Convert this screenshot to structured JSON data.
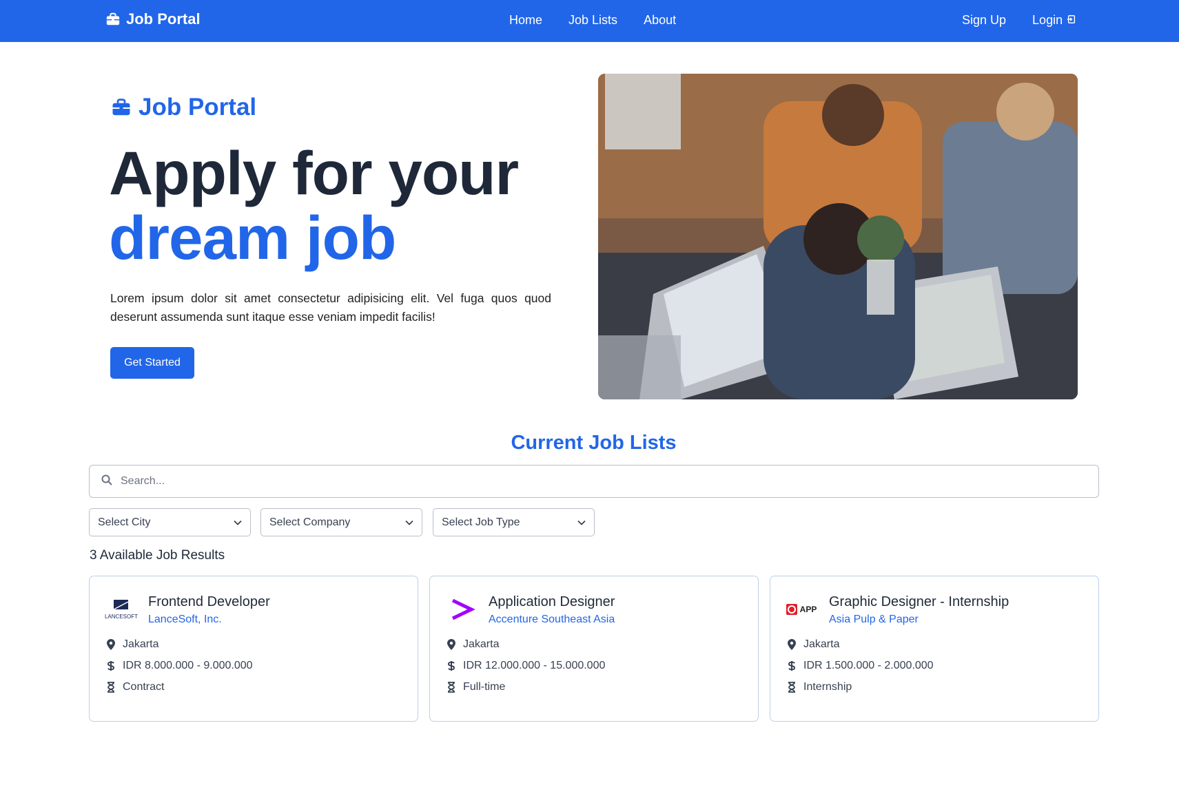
{
  "navbar": {
    "brand": "Job Portal",
    "links": [
      "Home",
      "Job Lists",
      "About"
    ],
    "signup": "Sign Up",
    "login": "Login"
  },
  "hero": {
    "brand": "Job Portal",
    "title_line1": "Apply for your",
    "title_line2": "dream job",
    "description": "Lorem ipsum dolor sit amet consectetur adipisicing elit. Vel fuga quos quod deserunt assumenda sunt itaque esse veniam impedit facilis!",
    "cta": "Get Started"
  },
  "joblist": {
    "title": "Current Job Lists",
    "search_placeholder": "Search...",
    "filters": [
      "Select City",
      "Select Company",
      "Select Job Type"
    ],
    "results_text": "3 Available Job Results",
    "jobs": [
      {
        "title": "Frontend Developer",
        "company": "LanceSoft, Inc.",
        "location": "Jakarta",
        "salary": "IDR 8.000.000 - 9.000.000",
        "type": "Contract",
        "logo_text": "LANCESOFT"
      },
      {
        "title": "Application Designer",
        "company": "Accenture Southeast Asia",
        "location": "Jakarta",
        "salary": "IDR 12.000.000 - 15.000.000",
        "type": "Full-time",
        "logo_text": ">"
      },
      {
        "title": "Graphic Designer - Internship",
        "company": "Asia Pulp & Paper",
        "location": "Jakarta",
        "salary": "IDR 1.500.000 - 2.000.000",
        "type": "Internship",
        "logo_text": "APP"
      }
    ]
  },
  "colors": {
    "primary": "#2166e8",
    "dark_text": "#1e2838",
    "card_border": "#bcd0ec"
  }
}
